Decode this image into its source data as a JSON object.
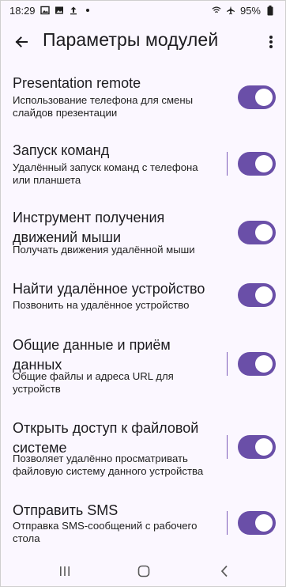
{
  "status_bar": {
    "time": "18:29",
    "battery": "95%",
    "icons": [
      "gallery-icon",
      "image-icon",
      "upload-icon",
      "dot-icon",
      "wifi-icon",
      "airplane-icon",
      "battery-icon"
    ]
  },
  "app_bar": {
    "title": "Параметры модулей",
    "back_icon": "arrow-back-icon",
    "more_icon": "more-vert-icon"
  },
  "settings": [
    {
      "title": "Presentation remote",
      "summary": "Использование телефона для смены слайдов презентации",
      "enabled": true,
      "has_divider": false
    },
    {
      "title": "Запуск команд",
      "summary": "Удалённый запуск команд с телефона или планшета",
      "enabled": true,
      "has_divider": true
    },
    {
      "title": "Инструмент получения движений мыши",
      "summary": "Получать движения удалённой мыши",
      "enabled": true,
      "has_divider": false
    },
    {
      "title": "Найти удалённое устройство",
      "summary": "Позвонить на удалённое устройство",
      "enabled": true,
      "has_divider": false
    },
    {
      "title": "Общие данные и приём данных",
      "summary": "Общие файлы и адреса URL для устройств",
      "enabled": true,
      "has_divider": true
    },
    {
      "title": "Открыть доступ к файловой системе",
      "summary": "Позволяет удалённо просматривать файловую систему данного устройства",
      "enabled": true,
      "has_divider": true
    },
    {
      "title": "Отправить SMS",
      "summary": "Отправка SMS-сообщений с рабочего стола",
      "enabled": true,
      "has_divider": true
    }
  ],
  "nav_bar": {
    "recents_icon": "recents-icon",
    "home_icon": "home-icon",
    "back_icon": "nav-back-icon"
  },
  "colors": {
    "background": "#FBF7FF",
    "switch_track": "#6A4FA8",
    "switch_knob": "#FFFFFF",
    "text_primary": "#1C1B1F",
    "divider": "#7C5CB8"
  }
}
